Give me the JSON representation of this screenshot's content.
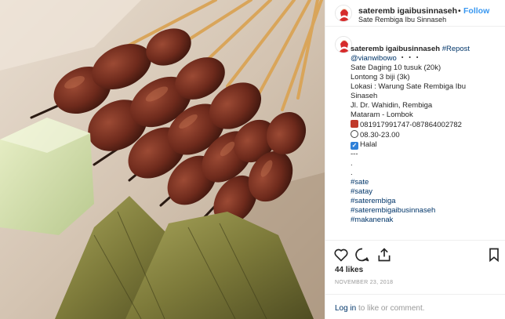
{
  "header": {
    "username": "sateremb igaibusinnaseh",
    "follow_dot": "•",
    "follow_label": "Follow",
    "location": "Sate Rembiga Ibu Sinnaseh"
  },
  "caption": {
    "username": "sateremb igaibusinnaseh",
    "repost": "#Repost",
    "mention": "@vianwibowo",
    "mention_suffix": "・・・",
    "lines": [
      "Sate Daging 10 tusuk (20k)",
      "Lontong 3 biji (3k)",
      "Lokasi : Warung Sate Rembiga Ibu",
      "Sinaseh",
      "Jl. Dr. Wahidin, Rembiga",
      "Mataram - Lombok"
    ],
    "phone": "081917991747-087864002782",
    "hours": "08.30-23.00",
    "halal": "Halal",
    "separators": [
      "---",
      ".",
      "."
    ],
    "hashtags": [
      "#sate",
      "#satay",
      "#saterembiga",
      "#saterembigaibusinnaseh",
      "#makanenak"
    ],
    "phone_icon": "telephone-icon",
    "clock_icon": "alarm-clock-icon",
    "check_icon": "check-box-icon"
  },
  "actions": {
    "like_icon": "heart-icon",
    "comment_icon": "comment-icon",
    "share_icon": "share-icon",
    "save_icon": "bookmark-icon"
  },
  "likes": "44 likes",
  "date": "NOVEMBER 23, 2018",
  "footer": {
    "login_label": "Log in",
    "login_suffix": " to like or comment."
  },
  "colors": {
    "link": "#003569",
    "follow": "#3897f0",
    "muted": "#999999",
    "border": "#efefef"
  }
}
